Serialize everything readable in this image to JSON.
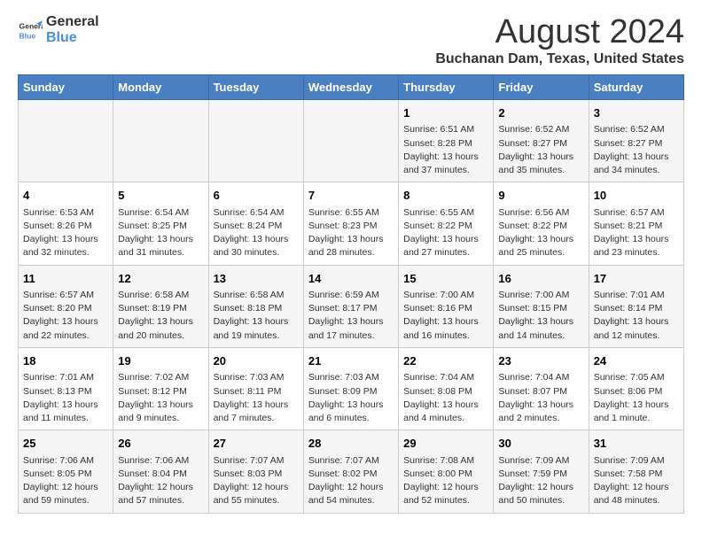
{
  "logo": {
    "line1": "General",
    "line2": "Blue"
  },
  "title": "August 2024",
  "subtitle": "Buchanan Dam, Texas, United States",
  "weekdays": [
    "Sunday",
    "Monday",
    "Tuesday",
    "Wednesday",
    "Thursday",
    "Friday",
    "Saturday"
  ],
  "weeks": [
    [
      {
        "day": "",
        "info": ""
      },
      {
        "day": "",
        "info": ""
      },
      {
        "day": "",
        "info": ""
      },
      {
        "day": "",
        "info": ""
      },
      {
        "day": "1",
        "info": "Sunrise: 6:51 AM\nSunset: 8:28 PM\nDaylight: 13 hours and 37 minutes."
      },
      {
        "day": "2",
        "info": "Sunrise: 6:52 AM\nSunset: 8:27 PM\nDaylight: 13 hours and 35 minutes."
      },
      {
        "day": "3",
        "info": "Sunrise: 6:52 AM\nSunset: 8:27 PM\nDaylight: 13 hours and 34 minutes."
      }
    ],
    [
      {
        "day": "4",
        "info": "Sunrise: 6:53 AM\nSunset: 8:26 PM\nDaylight: 13 hours and 32 minutes."
      },
      {
        "day": "5",
        "info": "Sunrise: 6:54 AM\nSunset: 8:25 PM\nDaylight: 13 hours and 31 minutes."
      },
      {
        "day": "6",
        "info": "Sunrise: 6:54 AM\nSunset: 8:24 PM\nDaylight: 13 hours and 30 minutes."
      },
      {
        "day": "7",
        "info": "Sunrise: 6:55 AM\nSunset: 8:23 PM\nDaylight: 13 hours and 28 minutes."
      },
      {
        "day": "8",
        "info": "Sunrise: 6:55 AM\nSunset: 8:22 PM\nDaylight: 13 hours and 27 minutes."
      },
      {
        "day": "9",
        "info": "Sunrise: 6:56 AM\nSunset: 8:22 PM\nDaylight: 13 hours and 25 minutes."
      },
      {
        "day": "10",
        "info": "Sunrise: 6:57 AM\nSunset: 8:21 PM\nDaylight: 13 hours and 23 minutes."
      }
    ],
    [
      {
        "day": "11",
        "info": "Sunrise: 6:57 AM\nSunset: 8:20 PM\nDaylight: 13 hours and 22 minutes."
      },
      {
        "day": "12",
        "info": "Sunrise: 6:58 AM\nSunset: 8:19 PM\nDaylight: 13 hours and 20 minutes."
      },
      {
        "day": "13",
        "info": "Sunrise: 6:58 AM\nSunset: 8:18 PM\nDaylight: 13 hours and 19 minutes."
      },
      {
        "day": "14",
        "info": "Sunrise: 6:59 AM\nSunset: 8:17 PM\nDaylight: 13 hours and 17 minutes."
      },
      {
        "day": "15",
        "info": "Sunrise: 7:00 AM\nSunset: 8:16 PM\nDaylight: 13 hours and 16 minutes."
      },
      {
        "day": "16",
        "info": "Sunrise: 7:00 AM\nSunset: 8:15 PM\nDaylight: 13 hours and 14 minutes."
      },
      {
        "day": "17",
        "info": "Sunrise: 7:01 AM\nSunset: 8:14 PM\nDaylight: 13 hours and 12 minutes."
      }
    ],
    [
      {
        "day": "18",
        "info": "Sunrise: 7:01 AM\nSunset: 8:13 PM\nDaylight: 13 hours and 11 minutes."
      },
      {
        "day": "19",
        "info": "Sunrise: 7:02 AM\nSunset: 8:12 PM\nDaylight: 13 hours and 9 minutes."
      },
      {
        "day": "20",
        "info": "Sunrise: 7:03 AM\nSunset: 8:11 PM\nDaylight: 13 hours and 7 minutes."
      },
      {
        "day": "21",
        "info": "Sunrise: 7:03 AM\nSunset: 8:09 PM\nDaylight: 13 hours and 6 minutes."
      },
      {
        "day": "22",
        "info": "Sunrise: 7:04 AM\nSunset: 8:08 PM\nDaylight: 13 hours and 4 minutes."
      },
      {
        "day": "23",
        "info": "Sunrise: 7:04 AM\nSunset: 8:07 PM\nDaylight: 13 hours and 2 minutes."
      },
      {
        "day": "24",
        "info": "Sunrise: 7:05 AM\nSunset: 8:06 PM\nDaylight: 13 hours and 1 minute."
      }
    ],
    [
      {
        "day": "25",
        "info": "Sunrise: 7:06 AM\nSunset: 8:05 PM\nDaylight: 12 hours and 59 minutes."
      },
      {
        "day": "26",
        "info": "Sunrise: 7:06 AM\nSunset: 8:04 PM\nDaylight: 12 hours and 57 minutes."
      },
      {
        "day": "27",
        "info": "Sunrise: 7:07 AM\nSunset: 8:03 PM\nDaylight: 12 hours and 55 minutes."
      },
      {
        "day": "28",
        "info": "Sunrise: 7:07 AM\nSunset: 8:02 PM\nDaylight: 12 hours and 54 minutes."
      },
      {
        "day": "29",
        "info": "Sunrise: 7:08 AM\nSunset: 8:00 PM\nDaylight: 12 hours and 52 minutes."
      },
      {
        "day": "30",
        "info": "Sunrise: 7:09 AM\nSunset: 7:59 PM\nDaylight: 12 hours and 50 minutes."
      },
      {
        "day": "31",
        "info": "Sunrise: 7:09 AM\nSunset: 7:58 PM\nDaylight: 12 hours and 48 minutes."
      }
    ]
  ]
}
